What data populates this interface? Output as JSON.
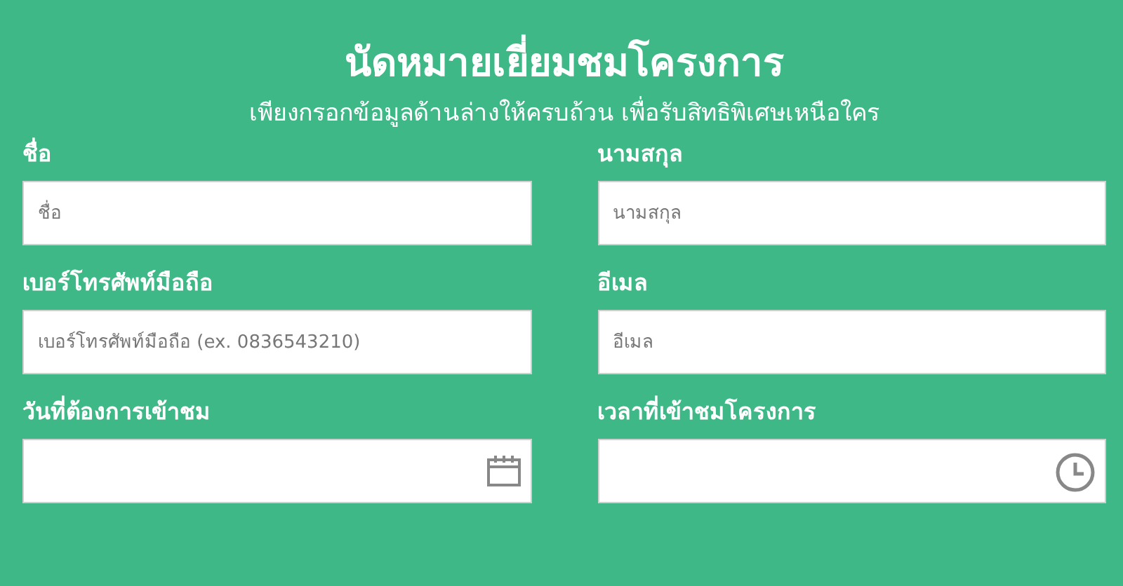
{
  "title": "นัดหมายเยี่ยมชมโครงการ",
  "subtitle": "เพียงกรอกข้อมูลด้านล่างให้ครบถ้วน เพื่อรับสิทธิพิเศษเหนือใคร",
  "fields": [
    {
      "kind": "text",
      "label": "ชื่อ",
      "placeholder": "ชื่อ"
    },
    {
      "kind": "text",
      "label": "นามสกุล",
      "placeholder": "นามสกุล"
    },
    {
      "kind": "text",
      "label": "เบอร์โทรศัพท์มือถือ",
      "placeholder": "เบอร์โทรศัพท์มือถือ (ex. 0836543210)"
    },
    {
      "kind": "text",
      "label": "อีเมล",
      "placeholder": "อีเมล"
    },
    {
      "kind": "date",
      "label": "วันที่ต้องการเข้าชม"
    },
    {
      "kind": "time",
      "label": "เวลาที่เข้าชมโครงการ"
    }
  ]
}
